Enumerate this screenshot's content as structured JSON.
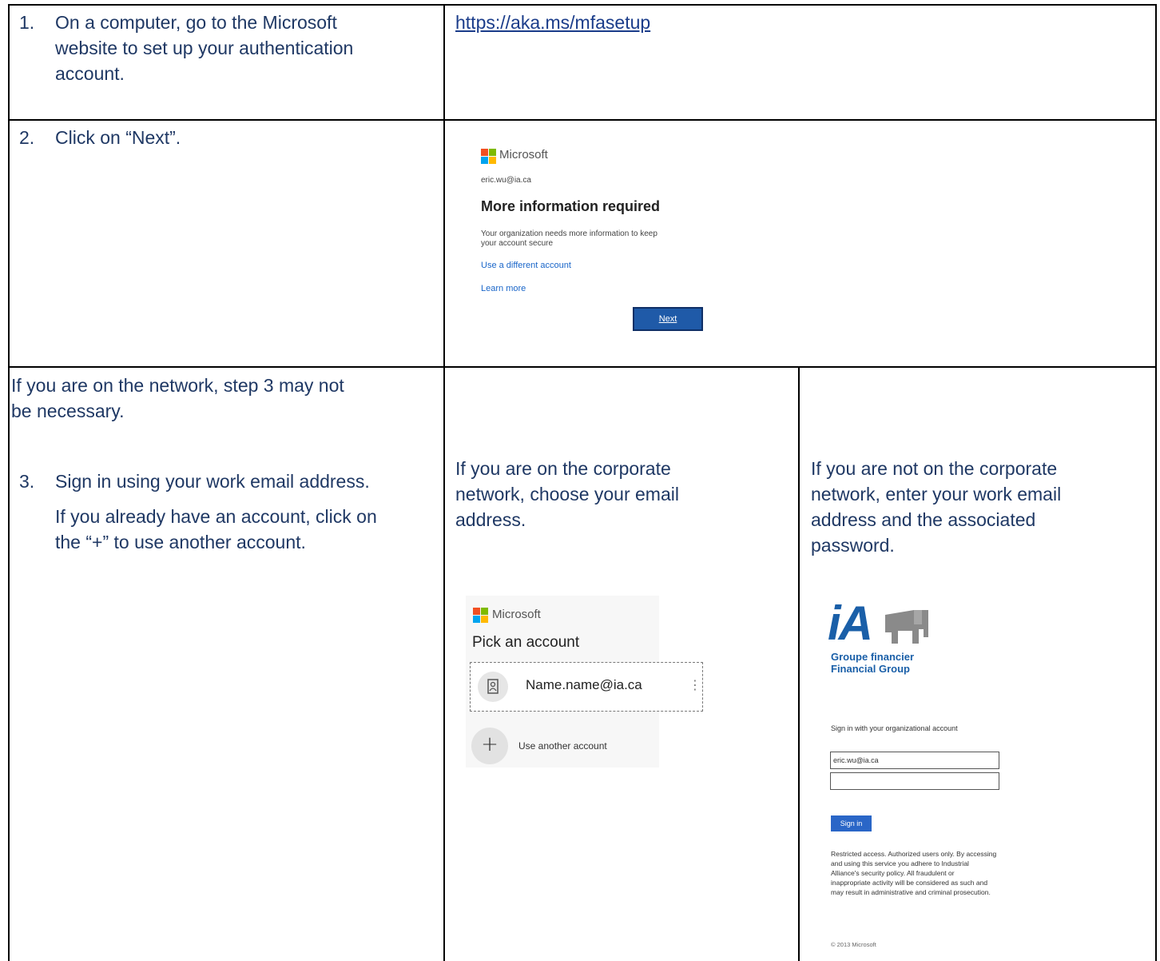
{
  "row1": {
    "num": "1.",
    "text_lines": [
      "On a computer, go to the Microsoft",
      "website to set up your authentication",
      "account."
    ],
    "url": "https://aka.ms/mfasetup"
  },
  "row2": {
    "num": "2.",
    "text": "Click on “Next”.",
    "ms_panel": {
      "brand": "Microsoft",
      "email": "eric.wu@ia.ca",
      "heading": "More information required",
      "body_lines": [
        "Your organization needs more information to keep",
        "your account secure"
      ],
      "link_different": "Use a different account",
      "link_learn": "Learn more",
      "next_label": "Next",
      "logo_colors": [
        "#f25022",
        "#7fba00",
        "#00a4ef",
        "#ffb900"
      ]
    }
  },
  "row3": {
    "note_lines": [
      "If you are on the network, step 3 may not",
      "be necessary."
    ],
    "num": "3.",
    "step_text": "Sign in using your work email address.",
    "step_sub_lines": [
      "If you already have an account, click on",
      "the “+” to use another account."
    ],
    "mid_lines": [
      "If you are on the corporate",
      "network, choose your email",
      "address."
    ],
    "right_lines": [
      "If you are not on the corporate",
      "network, enter your work email",
      "address and the associated",
      "password."
    ],
    "pick_panel": {
      "brand": "Microsoft",
      "heading": "Pick an account",
      "account": "Name.name@ia.ca",
      "more_glyph": "⋮",
      "add_glyph": "+",
      "use_another": "Use another account"
    },
    "ia_panel": {
      "logo_text": "iA",
      "group_line1": "Groupe financier",
      "group_line2": "Financial Group",
      "prompt": "Sign in with your organizational account",
      "email_value": "eric.wu@ia.ca",
      "signin_label": "Sign in",
      "fine_lines": [
        "Restricted access. Authorized users only. By accessing",
        "and using this service you adhere to Industrial",
        "Alliance's security policy. All fraudulent or",
        "inappropriate activity will be considered as such and",
        "may result in administrative and criminal prosecution."
      ],
      "copyright": "© 2013 Microsoft",
      "logo_color": "#1a5fa8"
    }
  }
}
